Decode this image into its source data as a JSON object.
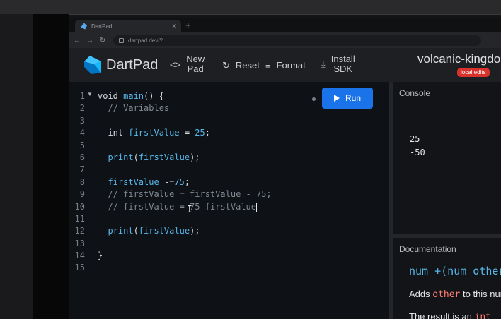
{
  "browser": {
    "tab_title": "DartPad",
    "url": "dartpad.dev/?"
  },
  "header": {
    "brand": "DartPad",
    "new_pad_label": "New\nPad",
    "reset_label": "Reset",
    "format_label": "Format",
    "install_sdk_label": "Install\nSDK",
    "pad_name": "volcanic-kingdom",
    "status_badge": "local edits",
    "brand_color": "#1a73e8"
  },
  "editor": {
    "run_label": "Run",
    "line_numbers": [
      "1",
      "2",
      "3",
      "4",
      "5",
      "6",
      "7",
      "8",
      "9",
      "10",
      "11",
      "12",
      "13",
      "14",
      "15"
    ],
    "lines": [
      "void main() {",
      "  // Variables",
      "",
      "  int firstValue = 25;",
      "",
      "  print(firstValue);",
      "",
      "  firstValue -=75;",
      "  // firstValue = firstValue - 75;",
      "  // firstValue = 75-firstValue",
      "",
      "  print(firstValue);",
      "",
      "}",
      ""
    ]
  },
  "console": {
    "title": "Console",
    "output": [
      "25",
      "-50"
    ]
  },
  "documentation": {
    "title": "Documentation",
    "signature": "num +(num other)",
    "line1_prefix": "Adds ",
    "line1_code": "other",
    "line1_suffix": " to this num.",
    "line2_prefix": "The result is an ",
    "line2_code": "int"
  }
}
